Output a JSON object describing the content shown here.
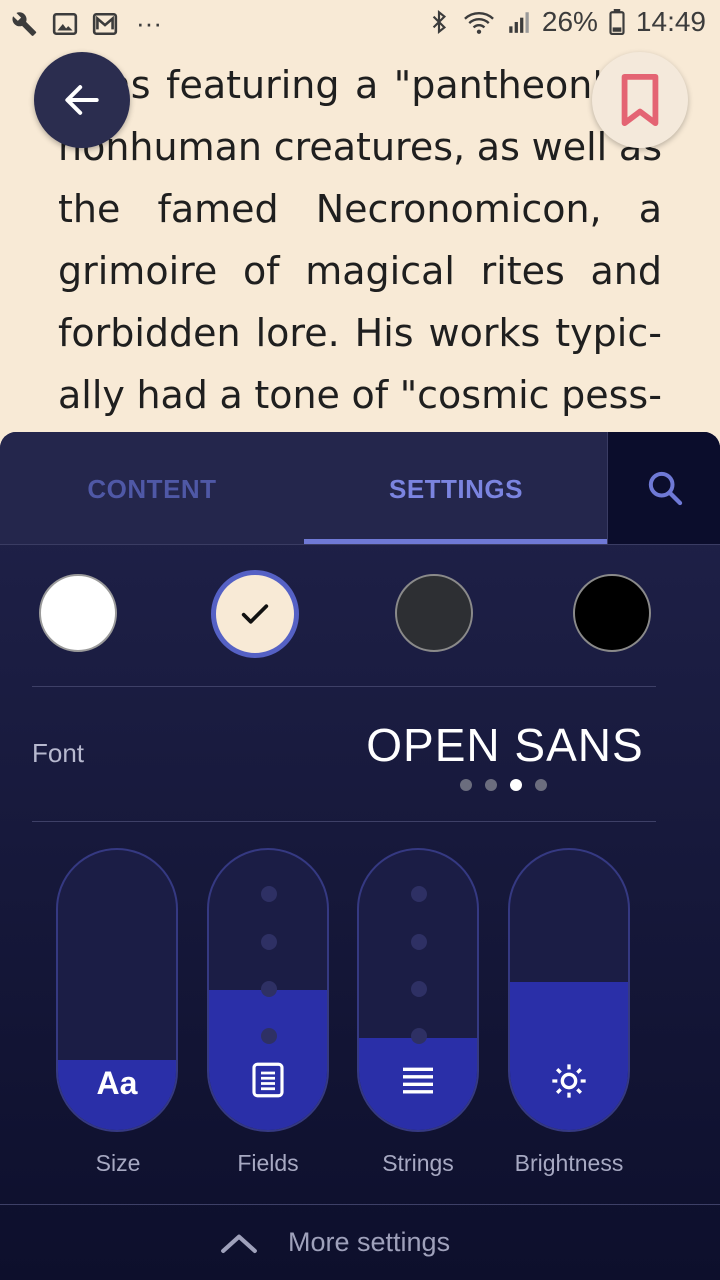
{
  "status_bar": {
    "left_icons": [
      "wrench-icon",
      "image-icon",
      "gmail-icon",
      "more-dots-icon"
    ],
    "overflow": "···",
    "battery_percent": "26%",
    "time": "14:49"
  },
  "reader": {
    "lines": [
      "tions featuring a \"pantheon\" of",
      "nonhuman creatures, as well as",
      "the famed Necronomicon, a",
      "grimoire of magical rites and",
      "forbidden lore. His works typic-",
      "ally had a tone of \"cosmic pess-"
    ],
    "background_color": "#f8ead6"
  },
  "tabs": [
    {
      "label": "CONTENT",
      "active": false
    },
    {
      "label": "SETTINGS",
      "active": true
    }
  ],
  "themes": [
    {
      "name": "white",
      "color": "#ffffff",
      "selected": false
    },
    {
      "name": "sepia",
      "color": "#f8ead6",
      "selected": true
    },
    {
      "name": "dark",
      "color": "#2d2f33",
      "selected": false
    },
    {
      "name": "black",
      "color": "#000000",
      "selected": false
    }
  ],
  "font": {
    "label": "Font",
    "current": "OPEN SANS",
    "page_count": 4,
    "page_index": 3
  },
  "sliders": [
    {
      "label": "Size",
      "icon": "font-size-icon",
      "glyph": "Aa",
      "level": 0.25
    },
    {
      "label": "Fields",
      "icon": "margins-icon",
      "level": 0.5
    },
    {
      "label": "Strings",
      "icon": "line-spacing-icon",
      "level": 0.33
    },
    {
      "label": "Brightness",
      "icon": "brightness-icon",
      "level": 0.53
    }
  ],
  "more_settings": {
    "label": "More settings"
  },
  "colors": {
    "accent": "#6f79d6",
    "bookmark": "#e46473",
    "panel": "#20224a",
    "slider_fill": "#2a2fa8"
  }
}
